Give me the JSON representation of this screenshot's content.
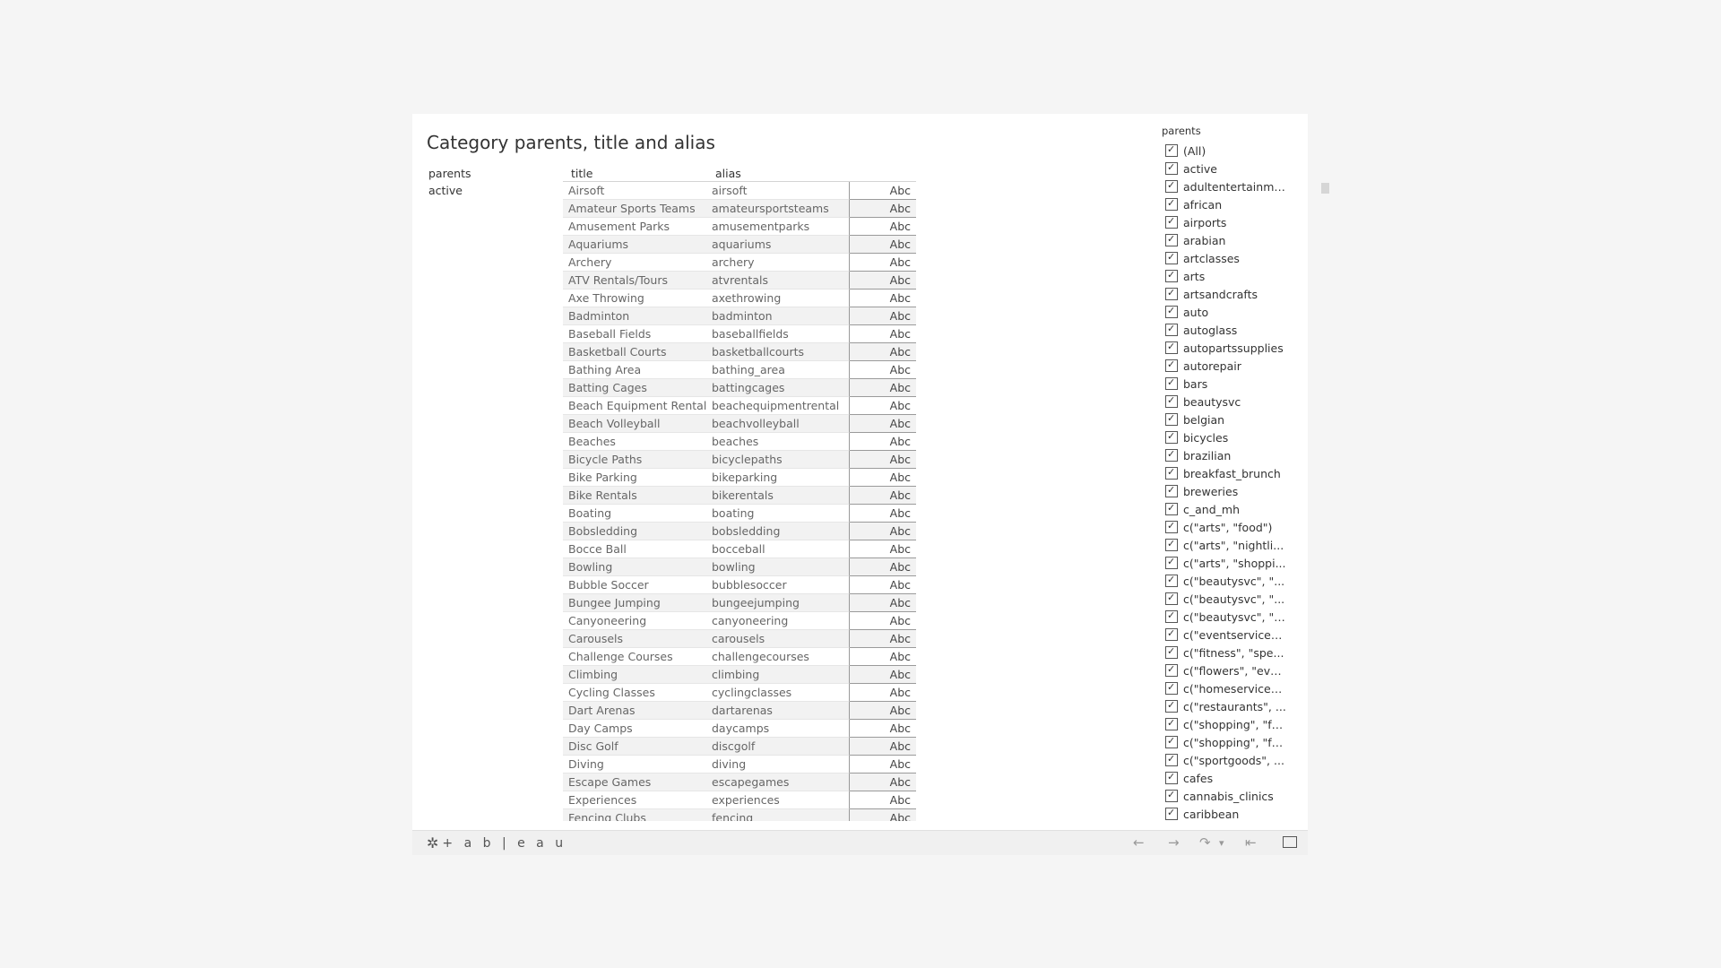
{
  "title": "Category parents, title and alias",
  "columns": {
    "parents": "parents",
    "title": "title",
    "alias": "alias"
  },
  "parent_value": "active",
  "rows": [
    {
      "title": "Airsoft",
      "alias": "airsoft",
      "type": "Abc"
    },
    {
      "title": "Amateur Sports Teams",
      "alias": "amateursportsteams",
      "type": "Abc"
    },
    {
      "title": "Amusement Parks",
      "alias": "amusementparks",
      "type": "Abc"
    },
    {
      "title": "Aquariums",
      "alias": "aquariums",
      "type": "Abc"
    },
    {
      "title": "Archery",
      "alias": "archery",
      "type": "Abc"
    },
    {
      "title": "ATV Rentals/Tours",
      "alias": "atvrentals",
      "type": "Abc"
    },
    {
      "title": "Axe Throwing",
      "alias": "axethrowing",
      "type": "Abc"
    },
    {
      "title": "Badminton",
      "alias": "badminton",
      "type": "Abc"
    },
    {
      "title": "Baseball Fields",
      "alias": "baseballfields",
      "type": "Abc"
    },
    {
      "title": "Basketball Courts",
      "alias": "basketballcourts",
      "type": "Abc"
    },
    {
      "title": "Bathing Area",
      "alias": "bathing_area",
      "type": "Abc"
    },
    {
      "title": "Batting Cages",
      "alias": "battingcages",
      "type": "Abc"
    },
    {
      "title": "Beach Equipment Rentals",
      "alias": "beachequipmentrental",
      "type": "Abc"
    },
    {
      "title": "Beach Volleyball",
      "alias": "beachvolleyball",
      "type": "Abc"
    },
    {
      "title": "Beaches",
      "alias": "beaches",
      "type": "Abc"
    },
    {
      "title": "Bicycle Paths",
      "alias": "bicyclepaths",
      "type": "Abc"
    },
    {
      "title": "Bike Parking",
      "alias": "bikeparking",
      "type": "Abc"
    },
    {
      "title": "Bike Rentals",
      "alias": "bikerentals",
      "type": "Abc"
    },
    {
      "title": "Boating",
      "alias": "boating",
      "type": "Abc"
    },
    {
      "title": "Bobsledding",
      "alias": "bobsledding",
      "type": "Abc"
    },
    {
      "title": "Bocce Ball",
      "alias": "bocceball",
      "type": "Abc"
    },
    {
      "title": "Bowling",
      "alias": "bowling",
      "type": "Abc"
    },
    {
      "title": "Bubble Soccer",
      "alias": "bubblesoccer",
      "type": "Abc"
    },
    {
      "title": "Bungee Jumping",
      "alias": "bungeejumping",
      "type": "Abc"
    },
    {
      "title": "Canyoneering",
      "alias": "canyoneering",
      "type": "Abc"
    },
    {
      "title": "Carousels",
      "alias": "carousels",
      "type": "Abc"
    },
    {
      "title": "Challenge Courses",
      "alias": "challengecourses",
      "type": "Abc"
    },
    {
      "title": "Climbing",
      "alias": "climbing",
      "type": "Abc"
    },
    {
      "title": "Cycling Classes",
      "alias": "cyclingclasses",
      "type": "Abc"
    },
    {
      "title": "Dart Arenas",
      "alias": "dartarenas",
      "type": "Abc"
    },
    {
      "title": "Day Camps",
      "alias": "daycamps",
      "type": "Abc"
    },
    {
      "title": "Disc Golf",
      "alias": "discgolf",
      "type": "Abc"
    },
    {
      "title": "Diving",
      "alias": "diving",
      "type": "Abc"
    },
    {
      "title": "Escape Games",
      "alias": "escapegames",
      "type": "Abc"
    },
    {
      "title": "Experiences",
      "alias": "experiences",
      "type": "Abc"
    },
    {
      "title": "Fencing Clubs",
      "alias": "fencing",
      "type": "Abc"
    }
  ],
  "filter": {
    "title": "parents",
    "items": [
      "(All)",
      "active",
      "adultentertainme...",
      "african",
      "airports",
      "arabian",
      "artclasses",
      "arts",
      "artsandcrafts",
      "auto",
      "autoglass",
      "autopartssupplies",
      "autorepair",
      "bars",
      "beautysvc",
      "belgian",
      "bicycles",
      "brazilian",
      "breakfast_brunch",
      "breweries",
      "c_and_mh",
      "c(\"arts\", \"food\")",
      "c(\"arts\", \"nightli...",
      "c(\"arts\", \"shoppi...",
      "c(\"beautysvc\", \"...",
      "c(\"beautysvc\", \"...",
      "c(\"beautysvc\", \"s...",
      "c(\"eventservices...",
      "c(\"fitness\", \"spe...",
      "c(\"flowers\", \"eve...",
      "c(\"homeservices...",
      "c(\"restaurants\", ...",
      "c(\"shopping\", \"fa...",
      "c(\"shopping\", \"fo...",
      "c(\"sportgoods\", ...",
      "cafes",
      "cannabis_clinics",
      "caribbean"
    ]
  },
  "footer": {
    "logo_text": "+ a b | e a u",
    "logo_mark": "✲"
  },
  "toolbar": {
    "undo": "←",
    "redo": "→",
    "revert": "↷",
    "dropdown": "▾",
    "reset": "⇤"
  }
}
